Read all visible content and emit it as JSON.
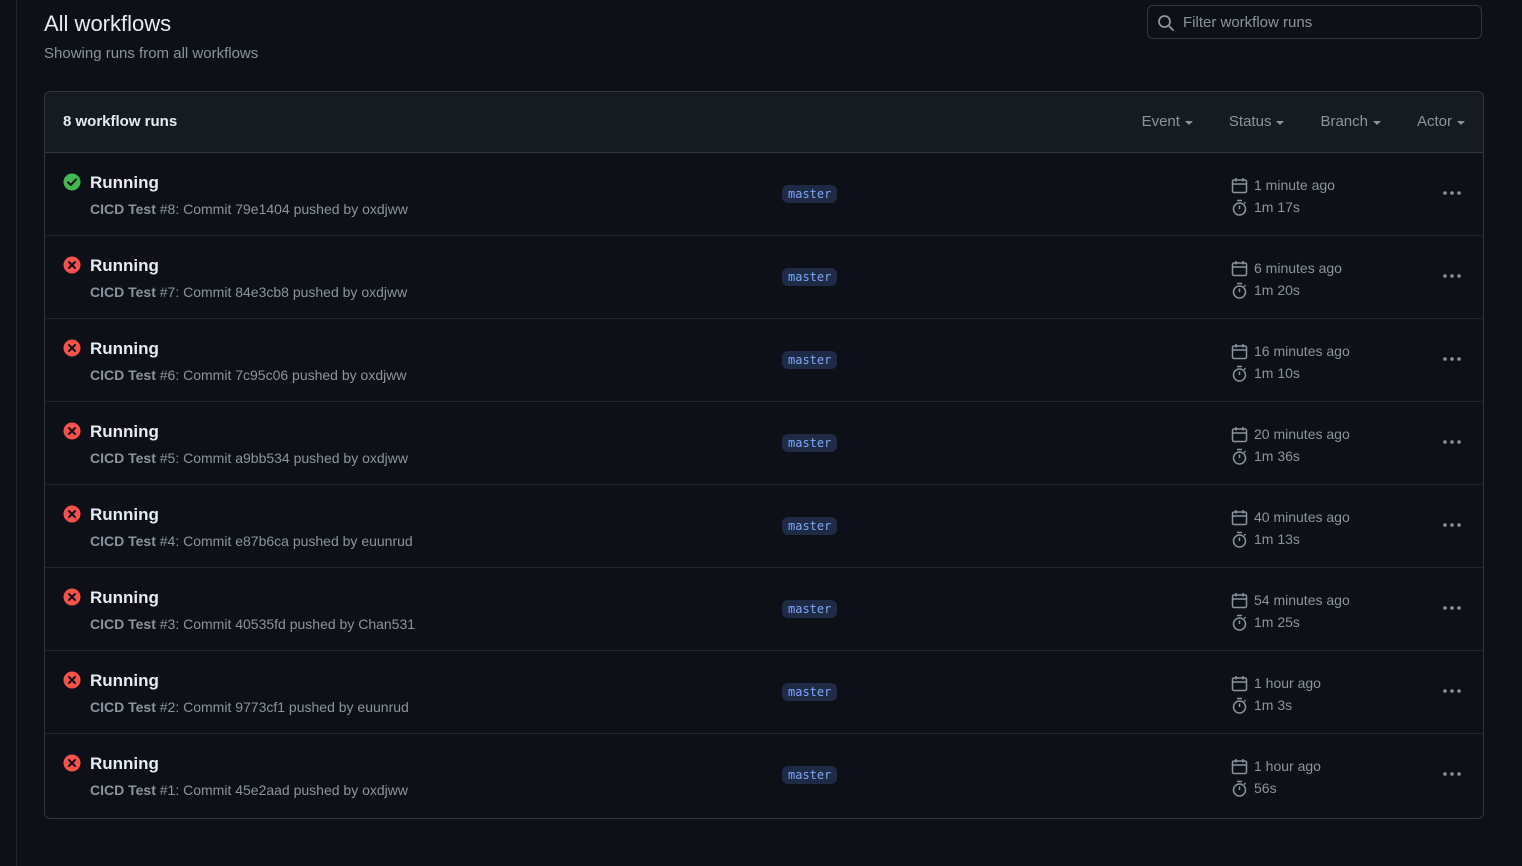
{
  "header": {
    "title": "All workflows",
    "subtitle": "Showing runs from all workflows"
  },
  "search": {
    "placeholder": "Filter workflow runs",
    "icon": "search-icon"
  },
  "runs_box": {
    "count_label": "8 workflow runs",
    "filters": [
      "Event",
      "Status",
      "Branch",
      "Actor"
    ]
  },
  "colors": {
    "success": "#3fb950",
    "failure": "#f85149",
    "branch_bg": "#1f2a44",
    "branch_fg": "#79a8ff"
  },
  "runs": [
    {
      "status": "success",
      "title": "Running",
      "workflow": "CICD Test",
      "run": "#8",
      "detail": ": Commit 79e1404 pushed by oxdjww",
      "branch": "master",
      "time_ago": "1 minute ago",
      "duration": "1m 17s"
    },
    {
      "status": "failure",
      "title": "Running",
      "workflow": "CICD Test",
      "run": "#7",
      "detail": ": Commit 84e3cb8 pushed by oxdjww",
      "branch": "master",
      "time_ago": "6 minutes ago",
      "duration": "1m 20s"
    },
    {
      "status": "failure",
      "title": "Running",
      "workflow": "CICD Test",
      "run": "#6",
      "detail": ": Commit 7c95c06 pushed by oxdjww",
      "branch": "master",
      "time_ago": "16 minutes ago",
      "duration": "1m 10s"
    },
    {
      "status": "failure",
      "title": "Running",
      "workflow": "CICD Test",
      "run": "#5",
      "detail": ": Commit a9bb534 pushed by oxdjww",
      "branch": "master",
      "time_ago": "20 minutes ago",
      "duration": "1m 36s"
    },
    {
      "status": "failure",
      "title": "Running",
      "workflow": "CICD Test",
      "run": "#4",
      "detail": ": Commit e87b6ca pushed by euunrud",
      "branch": "master",
      "time_ago": "40 minutes ago",
      "duration": "1m 13s"
    },
    {
      "status": "failure",
      "title": "Running",
      "workflow": "CICD Test",
      "run": "#3",
      "detail": ": Commit 40535fd pushed by Chan531",
      "branch": "master",
      "time_ago": "54 minutes ago",
      "duration": "1m 25s"
    },
    {
      "status": "failure",
      "title": "Running",
      "workflow": "CICD Test",
      "run": "#2",
      "detail": ": Commit 9773cf1 pushed by euunrud",
      "branch": "master",
      "time_ago": "1 hour ago",
      "duration": "1m 3s"
    },
    {
      "status": "failure",
      "title": "Running",
      "workflow": "CICD Test",
      "run": "#1",
      "detail": ": Commit 45e2aad pushed by oxdjww",
      "branch": "master",
      "time_ago": "1 hour ago",
      "duration": "56s"
    }
  ]
}
